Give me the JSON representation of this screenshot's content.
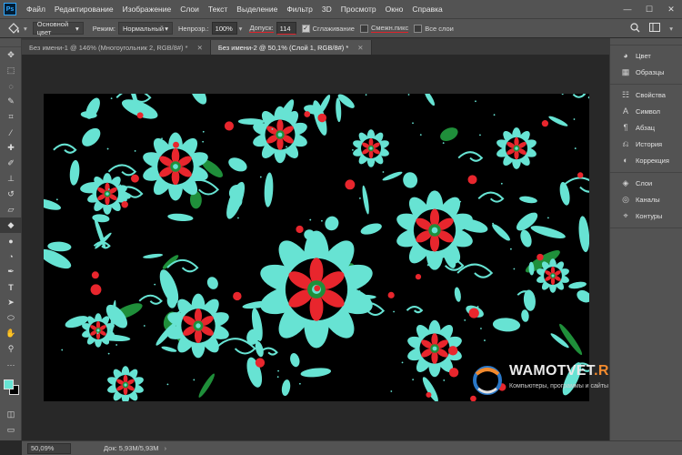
{
  "app": {
    "logo_text": "Ps"
  },
  "menu": [
    "Файл",
    "Редактирование",
    "Изображение",
    "Слои",
    "Текст",
    "Выделение",
    "Фильтр",
    "3D",
    "Просмотр",
    "Окно",
    "Справка"
  ],
  "window_controls": {
    "minimize": "—",
    "maximize": "☐",
    "close": "✕"
  },
  "options": {
    "sample_select": "Основной цвет",
    "mode_label": "Режим:",
    "mode_value": "Нормальный",
    "opacity_label": "Непрозр.:",
    "opacity_value": "100%",
    "tolerance_label": "Допуск:",
    "tolerance_value": "114",
    "antialias_label": "Сглаживание",
    "antialias_checked": true,
    "contiguous_label": "Смежн.пикс",
    "contiguous_checked": false,
    "all_layers_label": "Все слои",
    "all_layers_checked": false
  },
  "tabs": [
    {
      "label": "Без имени-1 @ 146% (Многоугольник 2, RGB/8#) *",
      "active": false
    },
    {
      "label": "Без имени-2 @ 50,1% (Слой 1, RGB/8#) *",
      "active": true
    }
  ],
  "status": {
    "zoom": "50,09%",
    "doc": "Док: 5,93M/5,93M",
    "arrow": "›"
  },
  "panels": {
    "group1": [
      {
        "icon": "color-wheel-icon",
        "glyph": "◕",
        "label": "Цвет"
      },
      {
        "icon": "swatches-icon",
        "glyph": "▦",
        "label": "Образцы"
      }
    ],
    "group2": [
      {
        "icon": "properties-icon",
        "glyph": "☷",
        "label": "Свойства"
      },
      {
        "icon": "character-icon",
        "glyph": "A",
        "label": "Символ"
      },
      {
        "icon": "paragraph-icon",
        "glyph": "¶",
        "label": "Абзац"
      },
      {
        "icon": "history-icon",
        "glyph": "⎌",
        "label": "История"
      },
      {
        "icon": "adjustments-icon",
        "glyph": "◐",
        "label": "Коррекция"
      }
    ],
    "group3": [
      {
        "icon": "layers-icon",
        "glyph": "◈",
        "label": "Слои"
      },
      {
        "icon": "channels-icon",
        "glyph": "◎",
        "label": "Каналы"
      },
      {
        "icon": "paths-icon",
        "glyph": "⌖",
        "label": "Контуры"
      }
    ]
  },
  "watermark": {
    "title_main": "WAMOTVET",
    "title_accent": ".RU",
    "subtitle": "Компьютеры, программы и сайты"
  },
  "colors": {
    "foreground": "#67e3d3",
    "background": "#000000",
    "accent_red": "#e0222a",
    "art_cyan": "#67e3d3",
    "art_red": "#e8262d",
    "art_green": "#1f8f3a"
  }
}
